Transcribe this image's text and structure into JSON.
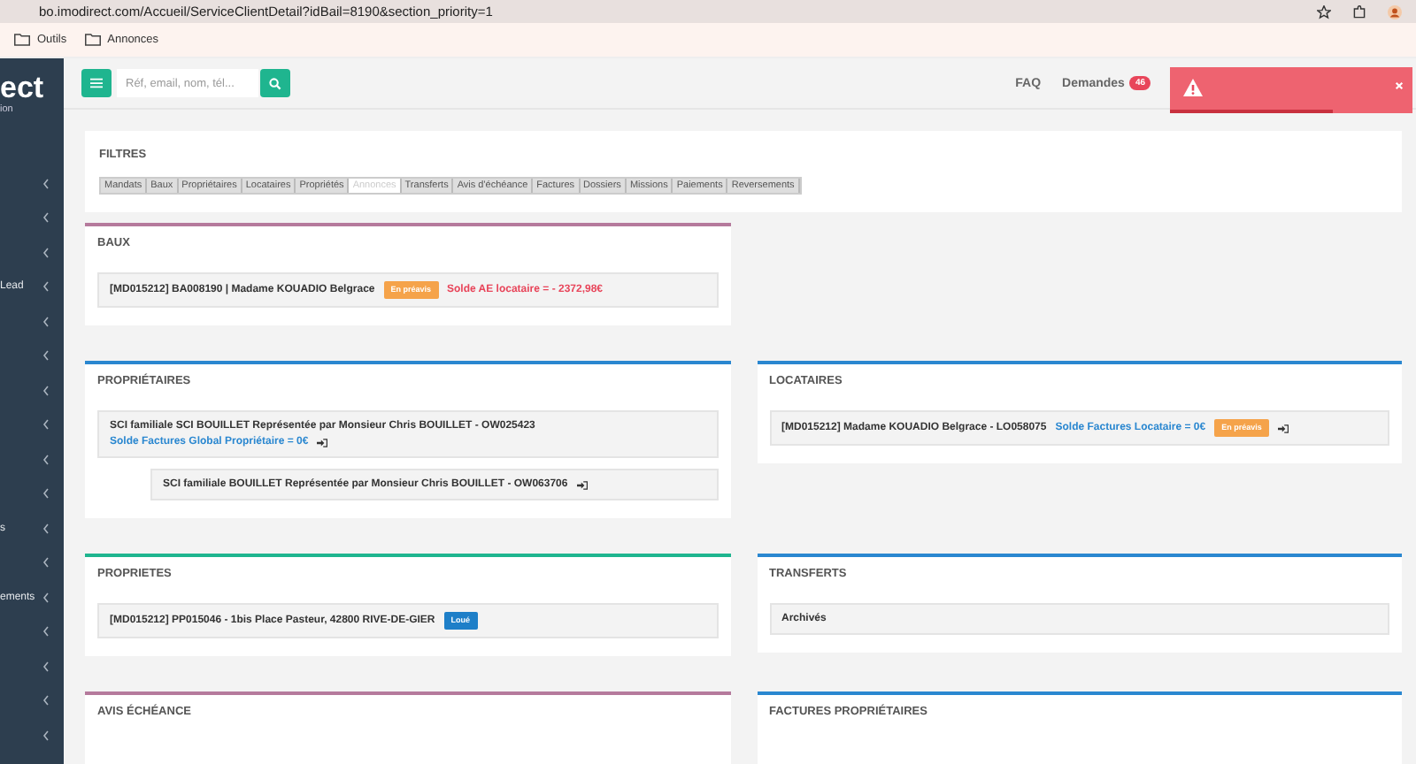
{
  "browser": {
    "url": "bo.imodirect.com/Accueil/ServiceClientDetail?idBail=8190&section_priority=1",
    "bookmarks": [
      "Outils",
      "Annonces"
    ]
  },
  "sidebar": {
    "logo": "ect",
    "logo_sub": "ion",
    "items": [
      {
        "expanded": false
      },
      {
        "expanded": false
      },
      {
        "expanded": false
      },
      {
        "label": "Lead",
        "expanded": false
      },
      {
        "expanded": false
      },
      {
        "expanded": false
      },
      {
        "expanded": false
      },
      {
        "expanded": false
      },
      {
        "expanded": false
      },
      {
        "expanded": false
      },
      {
        "label": "s",
        "expanded": false
      },
      {
        "expanded": false
      },
      {
        "label": "ements",
        "expanded": false
      },
      {
        "expanded": false
      },
      {
        "expanded": false
      },
      {
        "expanded": false
      },
      {
        "expanded": false
      }
    ]
  },
  "header": {
    "search": {
      "placeholder": "Réf, email, nom, tél..."
    },
    "links": [
      "FAQ",
      "Demandes"
    ],
    "badge": "46"
  },
  "alert": {
    "level": 0.67
  },
  "filters": {
    "title": "FILTRES",
    "items": [
      {
        "label": "Mandats",
        "disabled": false
      },
      {
        "label": "Baux",
        "disabled": false
      },
      {
        "label": "Propriétaires",
        "disabled": false
      },
      {
        "label": "Locataires",
        "disabled": false
      },
      {
        "label": "Propriétés",
        "disabled": false
      },
      {
        "label": "Annonces",
        "disabled": true
      },
      {
        "label": "Transferts",
        "disabled": false
      },
      {
        "label": "Avis d'échéance",
        "disabled": false
      },
      {
        "label": "Factures",
        "disabled": false
      },
      {
        "label": "Dossiers",
        "disabled": false
      },
      {
        "label": "Missions",
        "disabled": false
      },
      {
        "label": "Paiements",
        "disabled": false
      },
      {
        "label": "Reversements",
        "disabled": false
      }
    ]
  },
  "panels": [
    {
      "title": "BAUX",
      "color": "#b57a9c",
      "rows": [
        {
          "parts": [
            {
              "kind": "text",
              "text": "[MD015212] BA008190 | Madame KOUADIO Belgrace"
            },
            {
              "kind": "badge",
              "text": "En préavis",
              "color": "#f5a34a"
            },
            {
              "kind": "amount",
              "text": "Solde AE locataire = - 2372,98€",
              "color": "#e8455a"
            }
          ]
        }
      ]
    },
    {
      "title": "PROPRIÉTAIRES",
      "color": "#2a87d0",
      "rows": [
        {
          "parts": [
            {
              "kind": "text",
              "text": "SCI familiale SCI BOUILLET Représentée par Monsieur Chris BOUILLET - OW025423"
            },
            {
              "kind": "amount",
              "text": "Solde Factures Global Propriétaire = 0€",
              "color": "#2a87d0"
            },
            {
              "kind": "enter_icon"
            }
          ],
          "children": [
            {
              "parts": [
                {
                  "kind": "text",
                  "text": "SCI familiale BOUILLET Représentée par Monsieur Chris BOUILLET - OW063706"
                },
                {
                  "kind": "enter_icon"
                }
              ]
            }
          ]
        }
      ]
    },
    {
      "title": "LOCATAIRES",
      "color": "#2a87d0",
      "rows": [
        {
          "parts": [
            {
              "kind": "text",
              "text": "[MD015212] Madame KOUADIO Belgrace - LO058075"
            },
            {
              "kind": "amount",
              "text": "Solde Factures Locataire = 0€",
              "color": "#2a87d0"
            },
            {
              "kind": "badge",
              "text": "En préavis",
              "color": "#f5a34a"
            },
            {
              "kind": "enter_icon"
            }
          ]
        }
      ]
    },
    {
      "title": "PROPRIETES",
      "color": "#1fb58f",
      "rows": [
        {
          "parts": [
            {
              "kind": "text",
              "text": "[MD015212] PP015046 - 1bis Place Pasteur, 42800 RIVE-DE-GIER"
            },
            {
              "kind": "badge",
              "text": "Loué",
              "color": "#1e7fc8"
            }
          ]
        }
      ]
    },
    {
      "title": "TRANSFERTS",
      "color": "#2a87d0",
      "rows": [
        {
          "parts": [
            {
              "kind": "text",
              "text": "Archivés"
            }
          ]
        }
      ]
    },
    {
      "title": "AVIS ÉCHÉANCE",
      "color": "#b57a9c"
    },
    {
      "title": "FACTURES PROPRIÉTAIRES",
      "color": "#2a87d0"
    }
  ]
}
